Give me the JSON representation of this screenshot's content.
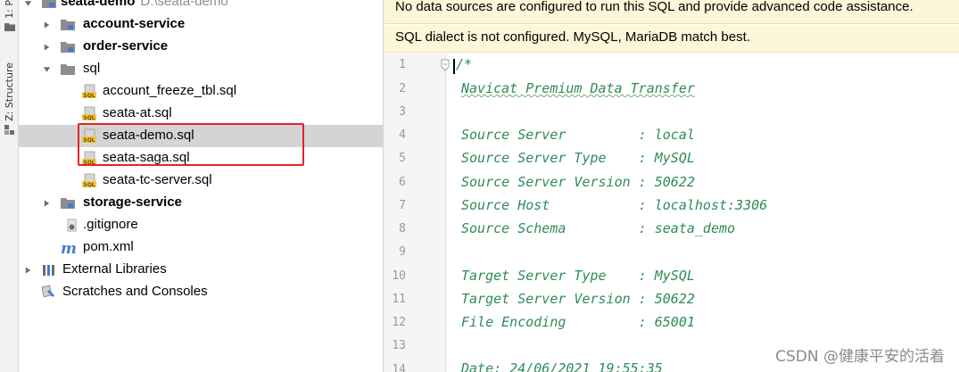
{
  "toolstrip": {
    "project_tab": "1: P",
    "structure_tab": "Z: Structure"
  },
  "tree": {
    "root": {
      "label": "seata-demo",
      "path": "D:\\seata-demo"
    },
    "items": [
      {
        "label": "account-service",
        "kind": "module"
      },
      {
        "label": "order-service",
        "kind": "module"
      },
      {
        "label": "sql",
        "kind": "folder"
      },
      {
        "label": "account_freeze_tbl.sql",
        "kind": "sql-file"
      },
      {
        "label": "seata-at.sql",
        "kind": "sql-file"
      },
      {
        "label": "seata-demo.sql",
        "kind": "sql-file",
        "selected": true
      },
      {
        "label": "seata-saga.sql",
        "kind": "sql-file"
      },
      {
        "label": "seata-tc-server.sql",
        "kind": "sql-file"
      },
      {
        "label": "storage-service",
        "kind": "module"
      },
      {
        "label": ".gitignore",
        "kind": "file"
      },
      {
        "label": "pom.xml",
        "kind": "maven-file"
      },
      {
        "label": "External Libraries",
        "kind": "libraries"
      },
      {
        "label": "Scratches and Consoles",
        "kind": "scratches"
      }
    ]
  },
  "editor": {
    "banners": [
      "No data sources are configured to run this SQL and provide advanced code assistance.",
      "SQL dialect is not configured. MySQL, MariaDB match best."
    ],
    "lines": [
      {
        "n": "1",
        "text": "/*"
      },
      {
        "n": "2",
        "text": "Navicat Premium Data Transfer"
      },
      {
        "n": "3",
        "text": ""
      },
      {
        "n": "4",
        "text": "Source Server         : local"
      },
      {
        "n": "5",
        "text": "Source Server Type    : MySQL"
      },
      {
        "n": "6",
        "text": "Source Server Version : 50622"
      },
      {
        "n": "7",
        "text": "Source Host           : localhost:3306"
      },
      {
        "n": "8",
        "text": "Source Schema         : seata_demo"
      },
      {
        "n": "9",
        "text": ""
      },
      {
        "n": "10",
        "text": "Target Server Type    : MySQL"
      },
      {
        "n": "11",
        "text": "Target Server Version : 50622"
      },
      {
        "n": "12",
        "text": "File Encoding         : 65001"
      },
      {
        "n": "13",
        "text": ""
      },
      {
        "n": "14",
        "text": "Date: 24/06/2021 19:55:35"
      }
    ],
    "colors": {
      "comment": "#2e8b57",
      "banner": "#fdf6d8",
      "highlight": "#e0242b"
    }
  },
  "watermark": "CSDN @健康平安的活着"
}
